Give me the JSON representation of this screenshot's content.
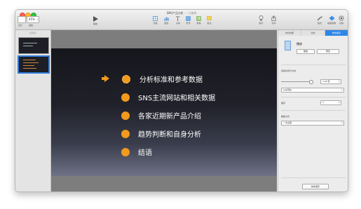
{
  "window": {
    "title": "SNS产品分析",
    "title_suffix": "— 已编辑"
  },
  "toolbar": {
    "view_label": "显示",
    "zoom_value": "45%",
    "zoom_label": "缩放",
    "play_label": "播放",
    "keynote_label": "Keynote Live",
    "table_label": "表格",
    "chart_label": "图表",
    "text_label": "文本",
    "shape_label": "形状",
    "media_label": "媒体",
    "comment_label": "批注",
    "share_label": "共享",
    "tips_label": "提示",
    "format_label": "格式",
    "animate_label": "动画效果",
    "document_label": "文稿"
  },
  "navigator": {
    "label": "幻灯片"
  },
  "slide": {
    "bullets": [
      {
        "text": "分析标准和参考数据"
      },
      {
        "text": "SNS主流网站和相关数据"
      },
      {
        "text": "各家近期新产品介绍"
      },
      {
        "text": "趋势判断和自身分析"
      },
      {
        "text": "结语"
      }
    ]
  },
  "inspector": {
    "tabs": [
      "构件效果",
      "动作",
      "构件顺序"
    ],
    "section_title": "播放",
    "preview_button": "播放",
    "build_button": "预览",
    "effect_title": "持续时间与方向",
    "duration_value": "1.00 秒",
    "direction_value": "从左到右",
    "order_label": "顺序",
    "order_value": "2",
    "delivery_title": "播放方式",
    "delivery_value": "一次全部",
    "footer_button": "构件顺序"
  },
  "colors": {
    "accent": "#f29a1d",
    "selection": "#2f86e6"
  }
}
